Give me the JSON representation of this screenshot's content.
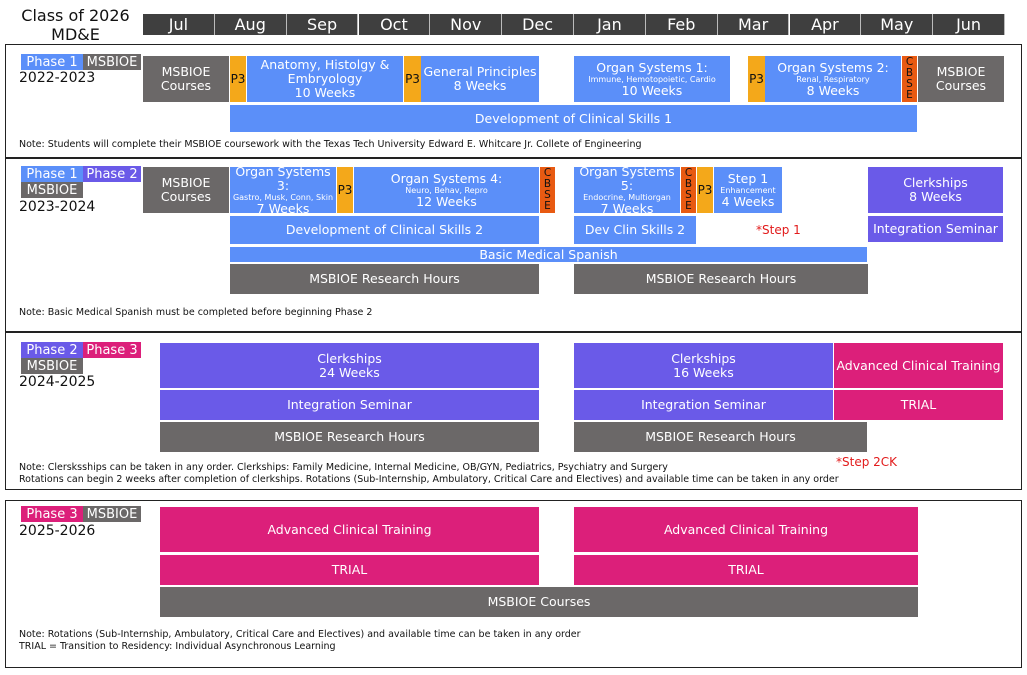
{
  "header": {
    "title_line1": "Class of 2026",
    "title_line2": "MD&E",
    "months": [
      "Jul",
      "Aug",
      "Sep",
      "Oct",
      "Nov",
      "Dec",
      "Jan",
      "Feb",
      "Mar",
      "Apr",
      "May",
      "Jun"
    ]
  },
  "colors": {
    "phase1": "#5b8ff9",
    "phase2": "#6a5ae8",
    "phase3": "#dc1f7a",
    "msbioe": "#6b6868",
    "p3": "#f4a81a",
    "cbse": "#e85a12",
    "step": "#e21b1b"
  },
  "s1": {
    "tag1": "Phase 1",
    "tag2": "MSBIOE",
    "year": "2022-2023",
    "msbioe_courses_l": "MSBIOE",
    "msbioe_courses_l2": "Courses",
    "p3": "P3",
    "anat_l1": "Anatomy, Histolgy &",
    "anat_l2": "Embryology",
    "anat_l3": "10 Weeks",
    "gp_l1": "General Principles",
    "gp_l2": "8 Weeks",
    "os1_l1": "Organ Systems 1:",
    "os1_sub": "Immune, Hemotopoietic, Cardio",
    "os1_l3": "10 Weeks",
    "os2_l1": "Organ Systems 2:",
    "os2_sub": "Renal, Respiratory",
    "os2_l3": "8 Weeks",
    "cbse": [
      "C",
      "B",
      "S",
      "E"
    ],
    "msbioe_courses_r": "MSBIOE",
    "msbioe_courses_r2": "Courses",
    "dcs1": "Development of Clinical Skills 1",
    "note": "Note: Students will complete their MSBIOE coursework with the Texas Tech University Edward E. Whitcare Jr. Collete of Engineering"
  },
  "s2": {
    "tag1": "Phase 1",
    "tag2": "Phase 2",
    "tag3": "MSBIOE",
    "year": "2023-2024",
    "msbioe_courses": "MSBIOE",
    "msbioe_courses2": "Courses",
    "os3_l1": "Organ Systems 3:",
    "os3_sub": "Gastro, Musk, Conn, Skin",
    "os3_l3": "7 Weeks",
    "p3": "P3",
    "os4_l1": "Organ Systems 4:",
    "os4_sub": "Neuro, Behav, Repro",
    "os4_l3": "12 Weeks",
    "cbse": [
      "C",
      "B",
      "S",
      "E"
    ],
    "os5_l1": "Organ Systems 5:",
    "os5_sub": "Endocrine, Multiorgan",
    "os5_l3": "7 Weeks",
    "step1_l1": "Step 1",
    "step1_sub": "Enhancement",
    "step1_l3": "4 Weeks",
    "clerk_l1": "Clerkships",
    "clerk_l2": "8 Weeks",
    "dcs2": "Development of Clinical Skills 2",
    "dev_clin": "Dev Clin Skills 2",
    "step1_marker": "*Step 1",
    "integ": "Integration Seminar",
    "spanish": "Basic Medical Spanish",
    "research": "MSBIOE Research Hours",
    "note": "Note: Basic Medical Spanish must be completed before beginning Phase 2"
  },
  "s3": {
    "tag1": "Phase 2",
    "tag2": "Phase 3",
    "tag3": "MSBIOE",
    "year": "2024-2025",
    "clerk_a_l1": "Clerkships",
    "clerk_a_l2": "24 Weeks",
    "clerk_b_l1": "Clerkships",
    "clerk_b_l2": "16 Weeks",
    "act": "Advanced Clinical Training",
    "integ": "Integration Seminar",
    "trial": "TRIAL",
    "research": "MSBIOE Research Hours",
    "step2": "*Step 2CK",
    "note1": "Note: Clersksships can be taken in any order. Clerkships: Family Medicine, Internal Medicine, OB/GYN, Pediatrics, Psychiatry and Surgery",
    "note2": "Rotations can begin 2 weeks after completion of clerkships. Rotations (Sub-Internship, Ambulatory, Critical Care and Electives) and available time can be taken in any order"
  },
  "s4": {
    "tag1": "Phase 3",
    "tag2": "MSBIOE",
    "year": "2025-2026",
    "act": "Advanced Clinical Training",
    "trial": "TRIAL",
    "courses": "MSBIOE Courses",
    "note1": "Note: Rotations (Sub-Internship, Ambulatory, Critical Care and Electives) and available time can be taken in any order",
    "note2": "TRIAL = Transition to Residency: Individual Asynchronous Learning"
  }
}
